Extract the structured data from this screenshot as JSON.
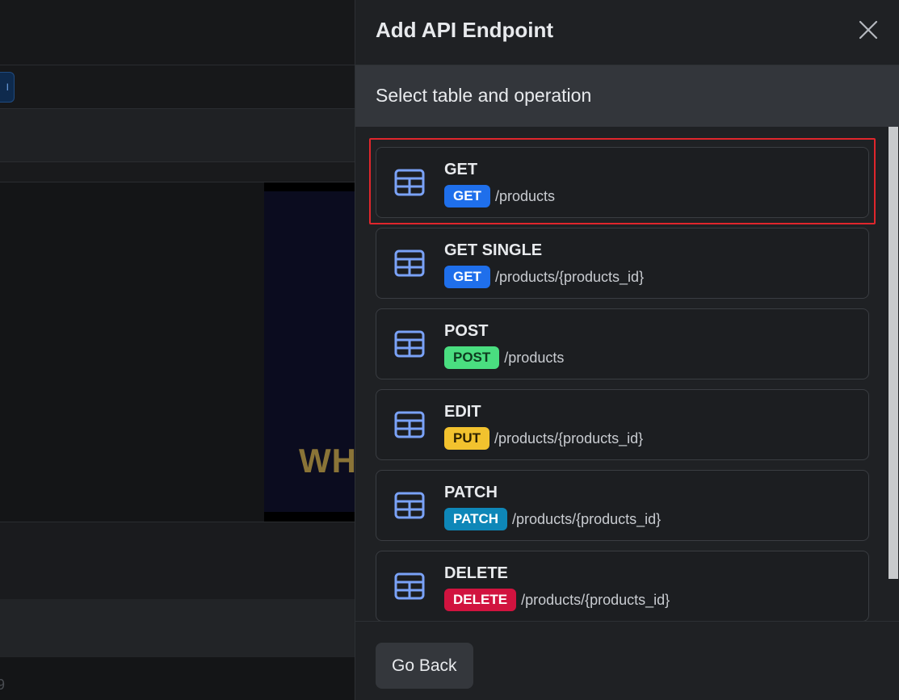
{
  "background": {
    "chip_label": "I",
    "preview_text": "WH",
    "footer_text": "9"
  },
  "drawer": {
    "title": "Add API Endpoint",
    "subtitle": "Select table and operation",
    "go_back_label": "Go Back",
    "close_icon": "close-icon"
  },
  "endpoints": [
    {
      "name": "GET",
      "method": "GET",
      "path": "/products",
      "badge": "get",
      "icon": "table-icon",
      "selected": true
    },
    {
      "name": "GET SINGLE",
      "method": "GET",
      "path": "/products/{products_id}",
      "badge": "get",
      "icon": "table-icon",
      "selected": false
    },
    {
      "name": "POST",
      "method": "POST",
      "path": "/products",
      "badge": "post",
      "icon": "table-icon",
      "selected": false
    },
    {
      "name": "EDIT",
      "method": "PUT",
      "path": "/products/{products_id}",
      "badge": "put",
      "icon": "table-icon",
      "selected": false
    },
    {
      "name": "PATCH",
      "method": "PATCH",
      "path": "/products/{products_id}",
      "badge": "patch",
      "icon": "table-icon",
      "selected": false
    },
    {
      "name": "DELETE",
      "method": "DELETE",
      "path": "/products/{products_id}",
      "badge": "delete",
      "icon": "table-icon",
      "selected": false
    }
  ],
  "colors": {
    "get": "#1f6feb",
    "post": "#4ade80",
    "put": "#f2c22e",
    "patch": "#0e87b8",
    "delete": "#d1133f",
    "highlight": "#e0262c",
    "icon": "#7aa2f7"
  }
}
